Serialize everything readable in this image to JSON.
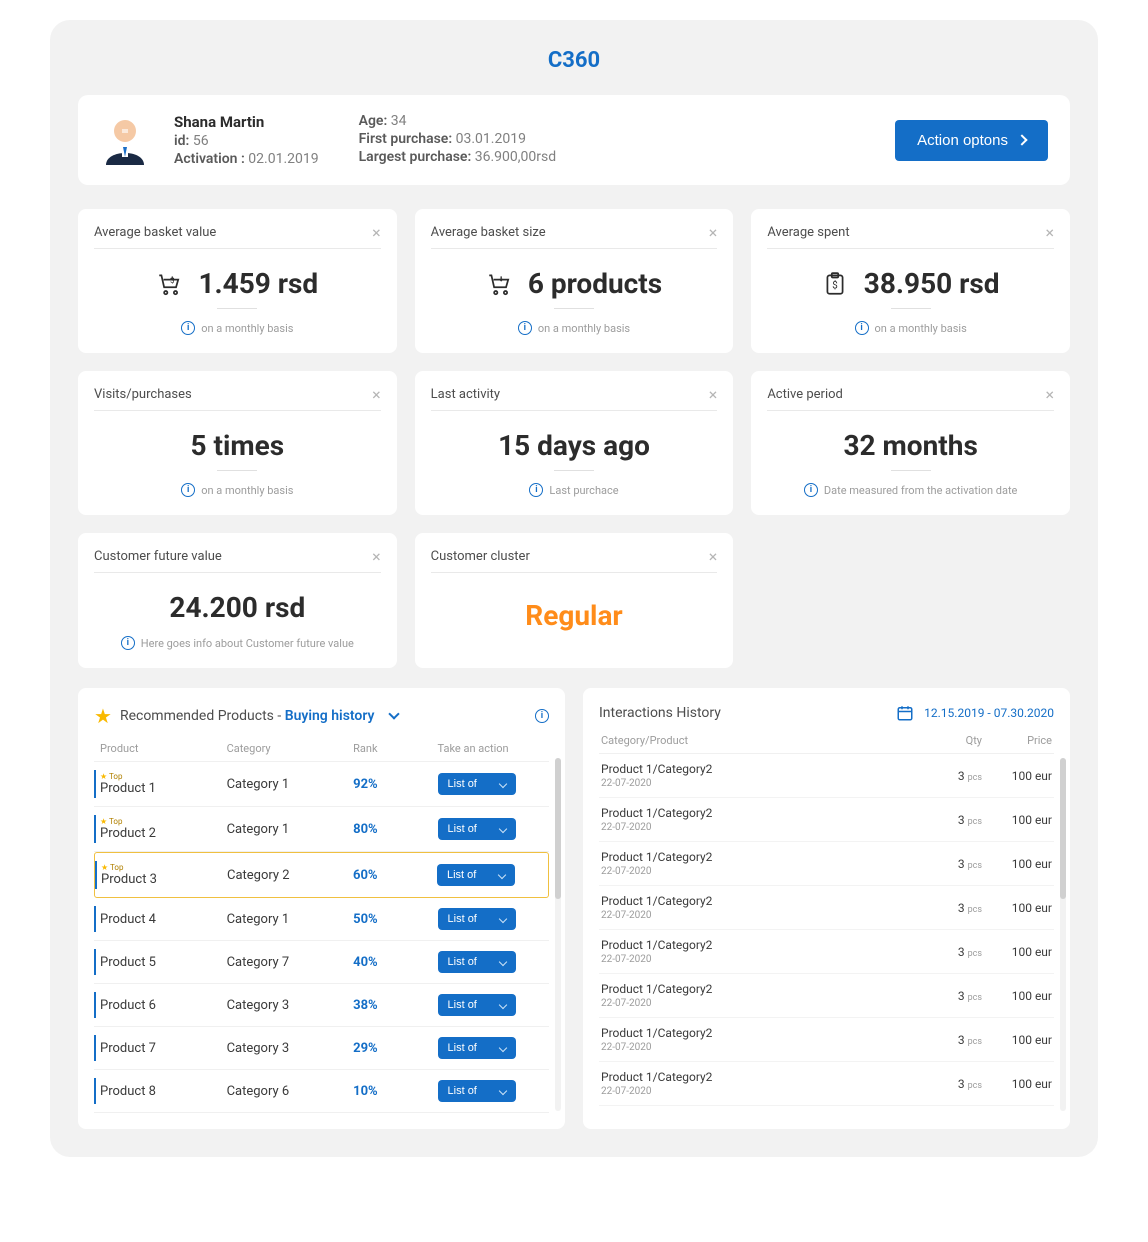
{
  "title": "C360",
  "profile": {
    "name": "Shana Martin",
    "id_label": "id:",
    "id": "56",
    "activation_label": "Activation :",
    "activation": "02.01.2019",
    "age_label": "Age:",
    "age": "34",
    "first_label": "First purchase:",
    "first": "03.01.2019",
    "largest_label": "Largest purchase:",
    "largest": "36.900,00rsd",
    "action_label": "Action optons"
  },
  "cards": {
    "avg_basket_value": {
      "title": "Average basket value",
      "value": "1.459 rsd",
      "note": "on a monthly basis"
    },
    "avg_basket_size": {
      "title": "Average basket size",
      "value": "6 products",
      "note": "on a monthly basis"
    },
    "avg_spent": {
      "title": "Average spent",
      "value": "38.950 rsd",
      "note": "on a monthly basis"
    },
    "visits": {
      "title": "Visits/purchases",
      "value": "5 times",
      "note": "on a monthly basis"
    },
    "last_activity": {
      "title": "Last activity",
      "value": "15 days ago",
      "note": "Last purchace"
    },
    "active_period": {
      "title": "Active period",
      "value": "32 months",
      "note": "Date measured from the activation date"
    },
    "future_value": {
      "title": "Customer future value",
      "value": "24.200 rsd",
      "note": "Here goes info about Customer future value"
    },
    "cluster": {
      "title": "Customer cluster",
      "value": "Regular"
    }
  },
  "recommended": {
    "title_prefix": "Recommended Products - ",
    "title_highlight": "Buying history",
    "cols": {
      "product": "Product",
      "category": "Category",
      "rank": "Rank",
      "action": "Take an action"
    },
    "listof_label": "List of",
    "top_label": "Top",
    "rows": [
      {
        "product": "Product 1",
        "category": "Category 1",
        "rank": "92%",
        "top": true
      },
      {
        "product": "Product 2",
        "category": "Category 1",
        "rank": "80%",
        "top": true
      },
      {
        "product": "Product 3",
        "category": "Category 2",
        "rank": "60%",
        "top": true,
        "highlight": true
      },
      {
        "product": "Product 4",
        "category": "Category 1",
        "rank": "50%"
      },
      {
        "product": "Product 5",
        "category": "Category 7",
        "rank": "40%"
      },
      {
        "product": "Product 6",
        "category": "Category 3",
        "rank": "38%"
      },
      {
        "product": "Product 7",
        "category": "Category 3",
        "rank": "29%"
      },
      {
        "product": "Product 8",
        "category": "Category 6",
        "rank": "10%"
      }
    ]
  },
  "history": {
    "title": "Interactions History",
    "range": "12.15.2019 - 07.30.2020",
    "cols": {
      "cat": "Category/Product",
      "qty": "Qty",
      "price": "Price"
    },
    "qty_unit": "pcs",
    "rows": [
      {
        "name": "Product 1/Category2",
        "date": "22-07-2020",
        "qty": "3",
        "price": "100 eur"
      },
      {
        "name": "Product 1/Category2",
        "date": "22-07-2020",
        "qty": "3",
        "price": "100 eur"
      },
      {
        "name": "Product 1/Category2",
        "date": "22-07-2020",
        "qty": "3",
        "price": "100 eur"
      },
      {
        "name": "Product 1/Category2",
        "date": "22-07-2020",
        "qty": "3",
        "price": "100 eur"
      },
      {
        "name": "Product 1/Category2",
        "date": "22-07-2020",
        "qty": "3",
        "price": "100 eur"
      },
      {
        "name": "Product 1/Category2",
        "date": "22-07-2020",
        "qty": "3",
        "price": "100 eur"
      },
      {
        "name": "Product 1/Category2",
        "date": "22-07-2020",
        "qty": "3",
        "price": "100 eur"
      },
      {
        "name": "Product 1/Category2",
        "date": "22-07-2020",
        "qty": "3",
        "price": "100 eur"
      }
    ]
  }
}
